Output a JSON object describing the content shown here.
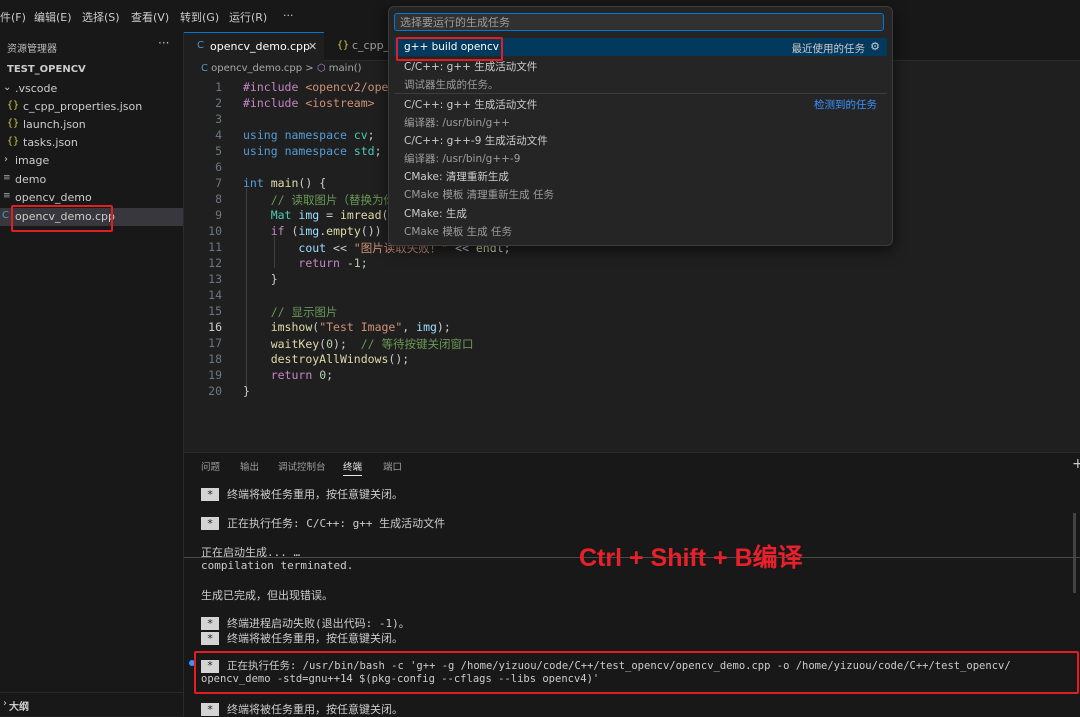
{
  "menu": [
    "件(F)",
    "编辑(E)",
    "选择(S)",
    "查看(V)",
    "转到(G)",
    "运行(R)",
    "···"
  ],
  "sidebar": {
    "title": "资源管理器",
    "more": "···",
    "root": "TEST_OPENCV",
    "items": [
      {
        "label": ".vscode",
        "icon": "chevron-down-icon"
      },
      {
        "label": "c_cpp_properties.json",
        "icon": "json-icon"
      },
      {
        "label": "launch.json",
        "icon": "json-icon"
      },
      {
        "label": "tasks.json",
        "icon": "json-icon"
      },
      {
        "label": "image",
        "icon": "chevron-right-icon"
      },
      {
        "label": "demo",
        "icon": "file-icon"
      },
      {
        "label": "opencv_demo",
        "icon": "file-icon"
      },
      {
        "label": "opencv_demo.cpp",
        "icon": "cpp-icon"
      }
    ],
    "outline": "大纲"
  },
  "tabs": [
    {
      "label": "opencv_demo.cpp",
      "close": "✕"
    },
    {
      "label": "c_cpp_"
    }
  ],
  "breadcrumb": {
    "file": "opencv_demo.cpp",
    "sep": ">",
    "symbol": "main()"
  },
  "editor": {
    "line_numbers": [
      "1",
      "2",
      "3",
      "4",
      "5",
      "6",
      "7",
      "8",
      "9",
      "10",
      "11",
      "12",
      "13",
      "14",
      "15",
      "16",
      "17",
      "18",
      "19",
      "20"
    ],
    "current_line": "16"
  },
  "quick_pick": {
    "placeholder": "选择要运行的生成任务",
    "items": [
      {
        "label": "g++ build opencv",
        "right": "最近使用的任务",
        "icon": "gear-icon"
      },
      {
        "label": "C/C++: g++ 生成活动文件"
      },
      {
        "label": "调试器生成的任务。"
      },
      {
        "label": "C/C++: g++ 生成活动文件",
        "right": "检测到的任务"
      },
      {
        "label": "编译器: /usr/bin/g++"
      },
      {
        "label": "C/C++: g++-9 生成活动文件"
      },
      {
        "label": "编译器: /usr/bin/g++-9"
      },
      {
        "label": "CMake: 清理重新生成"
      },
      {
        "label": "CMake 模板 清理重新生成 任务"
      },
      {
        "label": "CMake: 生成"
      },
      {
        "label": "CMake 模板 生成 任务"
      }
    ]
  },
  "panel": {
    "tabs": [
      "问题",
      "输出",
      "调试控制台",
      "终端",
      "端口"
    ],
    "active": "终端",
    "add": "+"
  },
  "terminal": {
    "star": "*",
    "lines": [
      "终端将被任务重用，按任意键关闭。",
      "正在执行任务: C/C++: g++ 生成活动文件",
      "正在启动生成... …",
      "compilation terminated.",
      "生成已完成，但出现错误。",
      "终端进程启动失败(退出代码: -1)。",
      "终端将被任务重用，按任意键关闭。",
      "正在执行任务: /usr/bin/bash -c 'g++ -g /home/yizuou/code/C++/test_opencv/opencv_demo.cpp -o /home/yizuou/code/C++/test_opencv/",
      "opencv_demo -std=gnu++14 $(pkg-config --cflags --libs opencv4)'",
      "终端将被任务重用，按任意键关闭。"
    ]
  },
  "annotation": "Ctrl + Shift + B编译",
  "colors": {
    "accent": "#0078d4",
    "highlight": "#e01e24",
    "selection": "#04395e"
  }
}
